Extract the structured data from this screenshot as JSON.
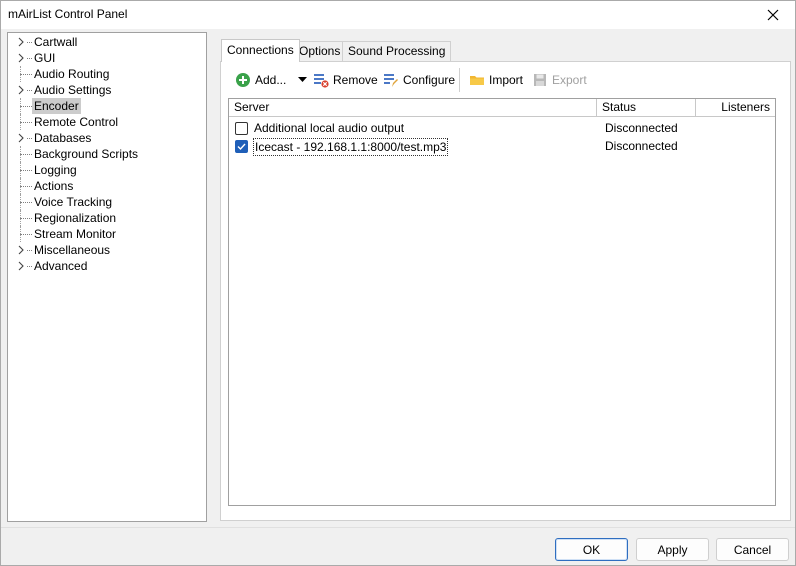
{
  "window": {
    "title": "mAirList Control Panel"
  },
  "tree": {
    "items": [
      {
        "label": "Cartwall",
        "expandable": true
      },
      {
        "label": "GUI",
        "expandable": true
      },
      {
        "label": "Audio Routing",
        "expandable": false
      },
      {
        "label": "Audio Settings",
        "expandable": true
      },
      {
        "label": "Encoder",
        "expandable": false,
        "selected": true
      },
      {
        "label": "Remote Control",
        "expandable": false
      },
      {
        "label": "Databases",
        "expandable": true
      },
      {
        "label": "Background Scripts",
        "expandable": false
      },
      {
        "label": "Logging",
        "expandable": false
      },
      {
        "label": "Actions",
        "expandable": false
      },
      {
        "label": "Voice Tracking",
        "expandable": false
      },
      {
        "label": "Regionalization",
        "expandable": false
      },
      {
        "label": "Stream Monitor",
        "expandable": false
      },
      {
        "label": "Miscellaneous",
        "expandable": true
      },
      {
        "label": "Advanced",
        "expandable": true
      }
    ]
  },
  "tabs": [
    {
      "label": "Connections",
      "active": true
    },
    {
      "label": "Options"
    },
    {
      "label": "Sound Processing"
    }
  ],
  "toolbar": {
    "add_label": "Add...",
    "remove_label": "Remove",
    "configure_label": "Configure",
    "import_label": "Import",
    "export_label": "Export"
  },
  "list": {
    "columns": {
      "server": "Server",
      "status": "Status",
      "listeners": "Listeners"
    },
    "rows": [
      {
        "server": "Additional local audio output",
        "status": "Disconnected",
        "checked": false
      },
      {
        "server": "Icecast - 192.168.1.1:8000/test.mp3",
        "status": "Disconnected",
        "checked": true
      }
    ]
  },
  "footer": {
    "ok_label": "OK",
    "apply_label": "Apply",
    "cancel_label": "Cancel"
  },
  "colors": {
    "accent": "#1f5fb8",
    "selected_tree_bg": "#cccccc",
    "add_icon": "#3aa24a"
  }
}
